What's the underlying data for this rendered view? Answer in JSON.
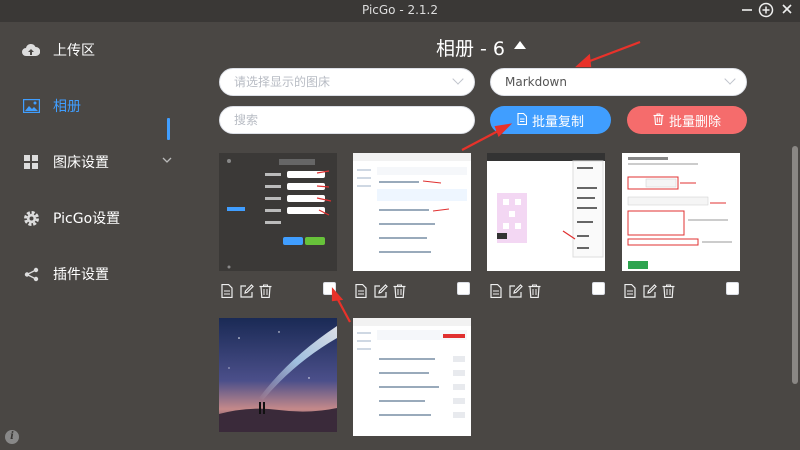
{
  "window": {
    "title": "PicGo - 2.1.2"
  },
  "sidebar": {
    "items": [
      {
        "label": "上传区",
        "icon": "cloud-upload-icon"
      },
      {
        "label": "相册",
        "icon": "image-icon"
      },
      {
        "label": "图床设置",
        "icon": "grid-icon"
      },
      {
        "label": "PicGo设置",
        "icon": "gear-icon"
      },
      {
        "label": "插件设置",
        "icon": "share-icon"
      }
    ],
    "active": "相册"
  },
  "header": {
    "title": "相册 - 6"
  },
  "filters": {
    "picbed_placeholder": "请选择显示的图床",
    "format_value": "Markdown",
    "search_placeholder": "搜索"
  },
  "actions": {
    "copy_label": "批量复制",
    "delete_label": "批量删除"
  },
  "colors": {
    "accent": "#409eff",
    "danger": "#f56c6c",
    "background": "#4a4744"
  },
  "gallery": {
    "count": 6
  }
}
